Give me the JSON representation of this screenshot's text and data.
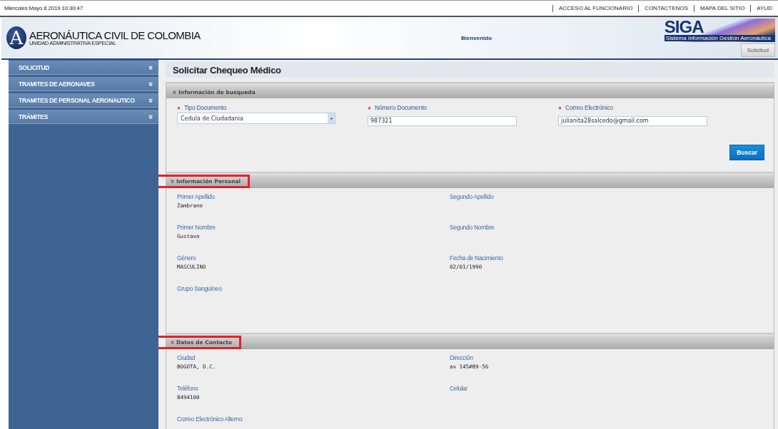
{
  "top_bar": {
    "datetime": "Miercoles Mayo 8 2019 10:30:47",
    "links": [
      "ACCESO AL FUNCIONARIO",
      "CONTACTENOS",
      "MAPA DEL SITIO",
      "AYUD"
    ]
  },
  "header": {
    "logo_letter": "A",
    "org_name": "AERONÁUTICA CIVIL DE COLOMBIA",
    "org_subtitle": "UNIDAD ADMINISTRATIVA ESPECIAL",
    "welcome": "Bienvenido",
    "siga_logo": "SIGA",
    "siga_subtitle": "Sistema Información Gestión Aeronáutica",
    "tab": "Solicitud"
  },
  "sidebar": {
    "items": [
      {
        "label": "SOLICITUD",
        "expanded": false
      },
      {
        "label": "TRAMITES DE AERONAVES",
        "expanded": false
      },
      {
        "label": "TRAMITES DE PERSONAL AERONAUTICO",
        "expanded": false
      },
      {
        "label": "TRÁMITES",
        "expanded": false
      }
    ]
  },
  "page_title": "Solicitar Chequeo Médico",
  "search_section": {
    "title": "Información de busqueda",
    "highlighted": false,
    "fields": [
      {
        "kind": "select",
        "label": "Tipo Documento",
        "required": true,
        "value": "Cedula de Ciudadania"
      },
      {
        "kind": "input",
        "label": "Número Documento",
        "required": true,
        "value": "987321"
      },
      {
        "kind": "input",
        "label": "Correo Electrónico",
        "required": true,
        "value": "julianita28salcedo@gmail.com"
      }
    ],
    "button": "Buscar"
  },
  "sections": [
    {
      "title": "Información Personal",
      "highlighted": true,
      "fields": [
        {
          "label": "Primer Apellido",
          "value": "Zambrano"
        },
        {
          "label": "Segundo Apellido"
        },
        {
          "label": "Primer Nombre",
          "value": "Gustavo"
        },
        {
          "label": "Segundo Nombre"
        },
        {
          "label": "Género",
          "value": "MASCULINO"
        },
        {
          "label": "Fecha de Nacimiento",
          "value": "02/01/1990"
        },
        {
          "label": "Grupo Sanguíneo"
        }
      ]
    },
    {
      "title": "Datos de Contacto",
      "highlighted": true,
      "fields": [
        {
          "label": "Ciudad",
          "value": "BOGOTA, D.C."
        },
        {
          "label": "Dirección",
          "value": "av 145#89-56"
        },
        {
          "label": "Teléfono",
          "value": "8494100"
        },
        {
          "label": "Celular"
        },
        {
          "label": "Correo Electrónico Alterno"
        }
      ]
    }
  ]
}
